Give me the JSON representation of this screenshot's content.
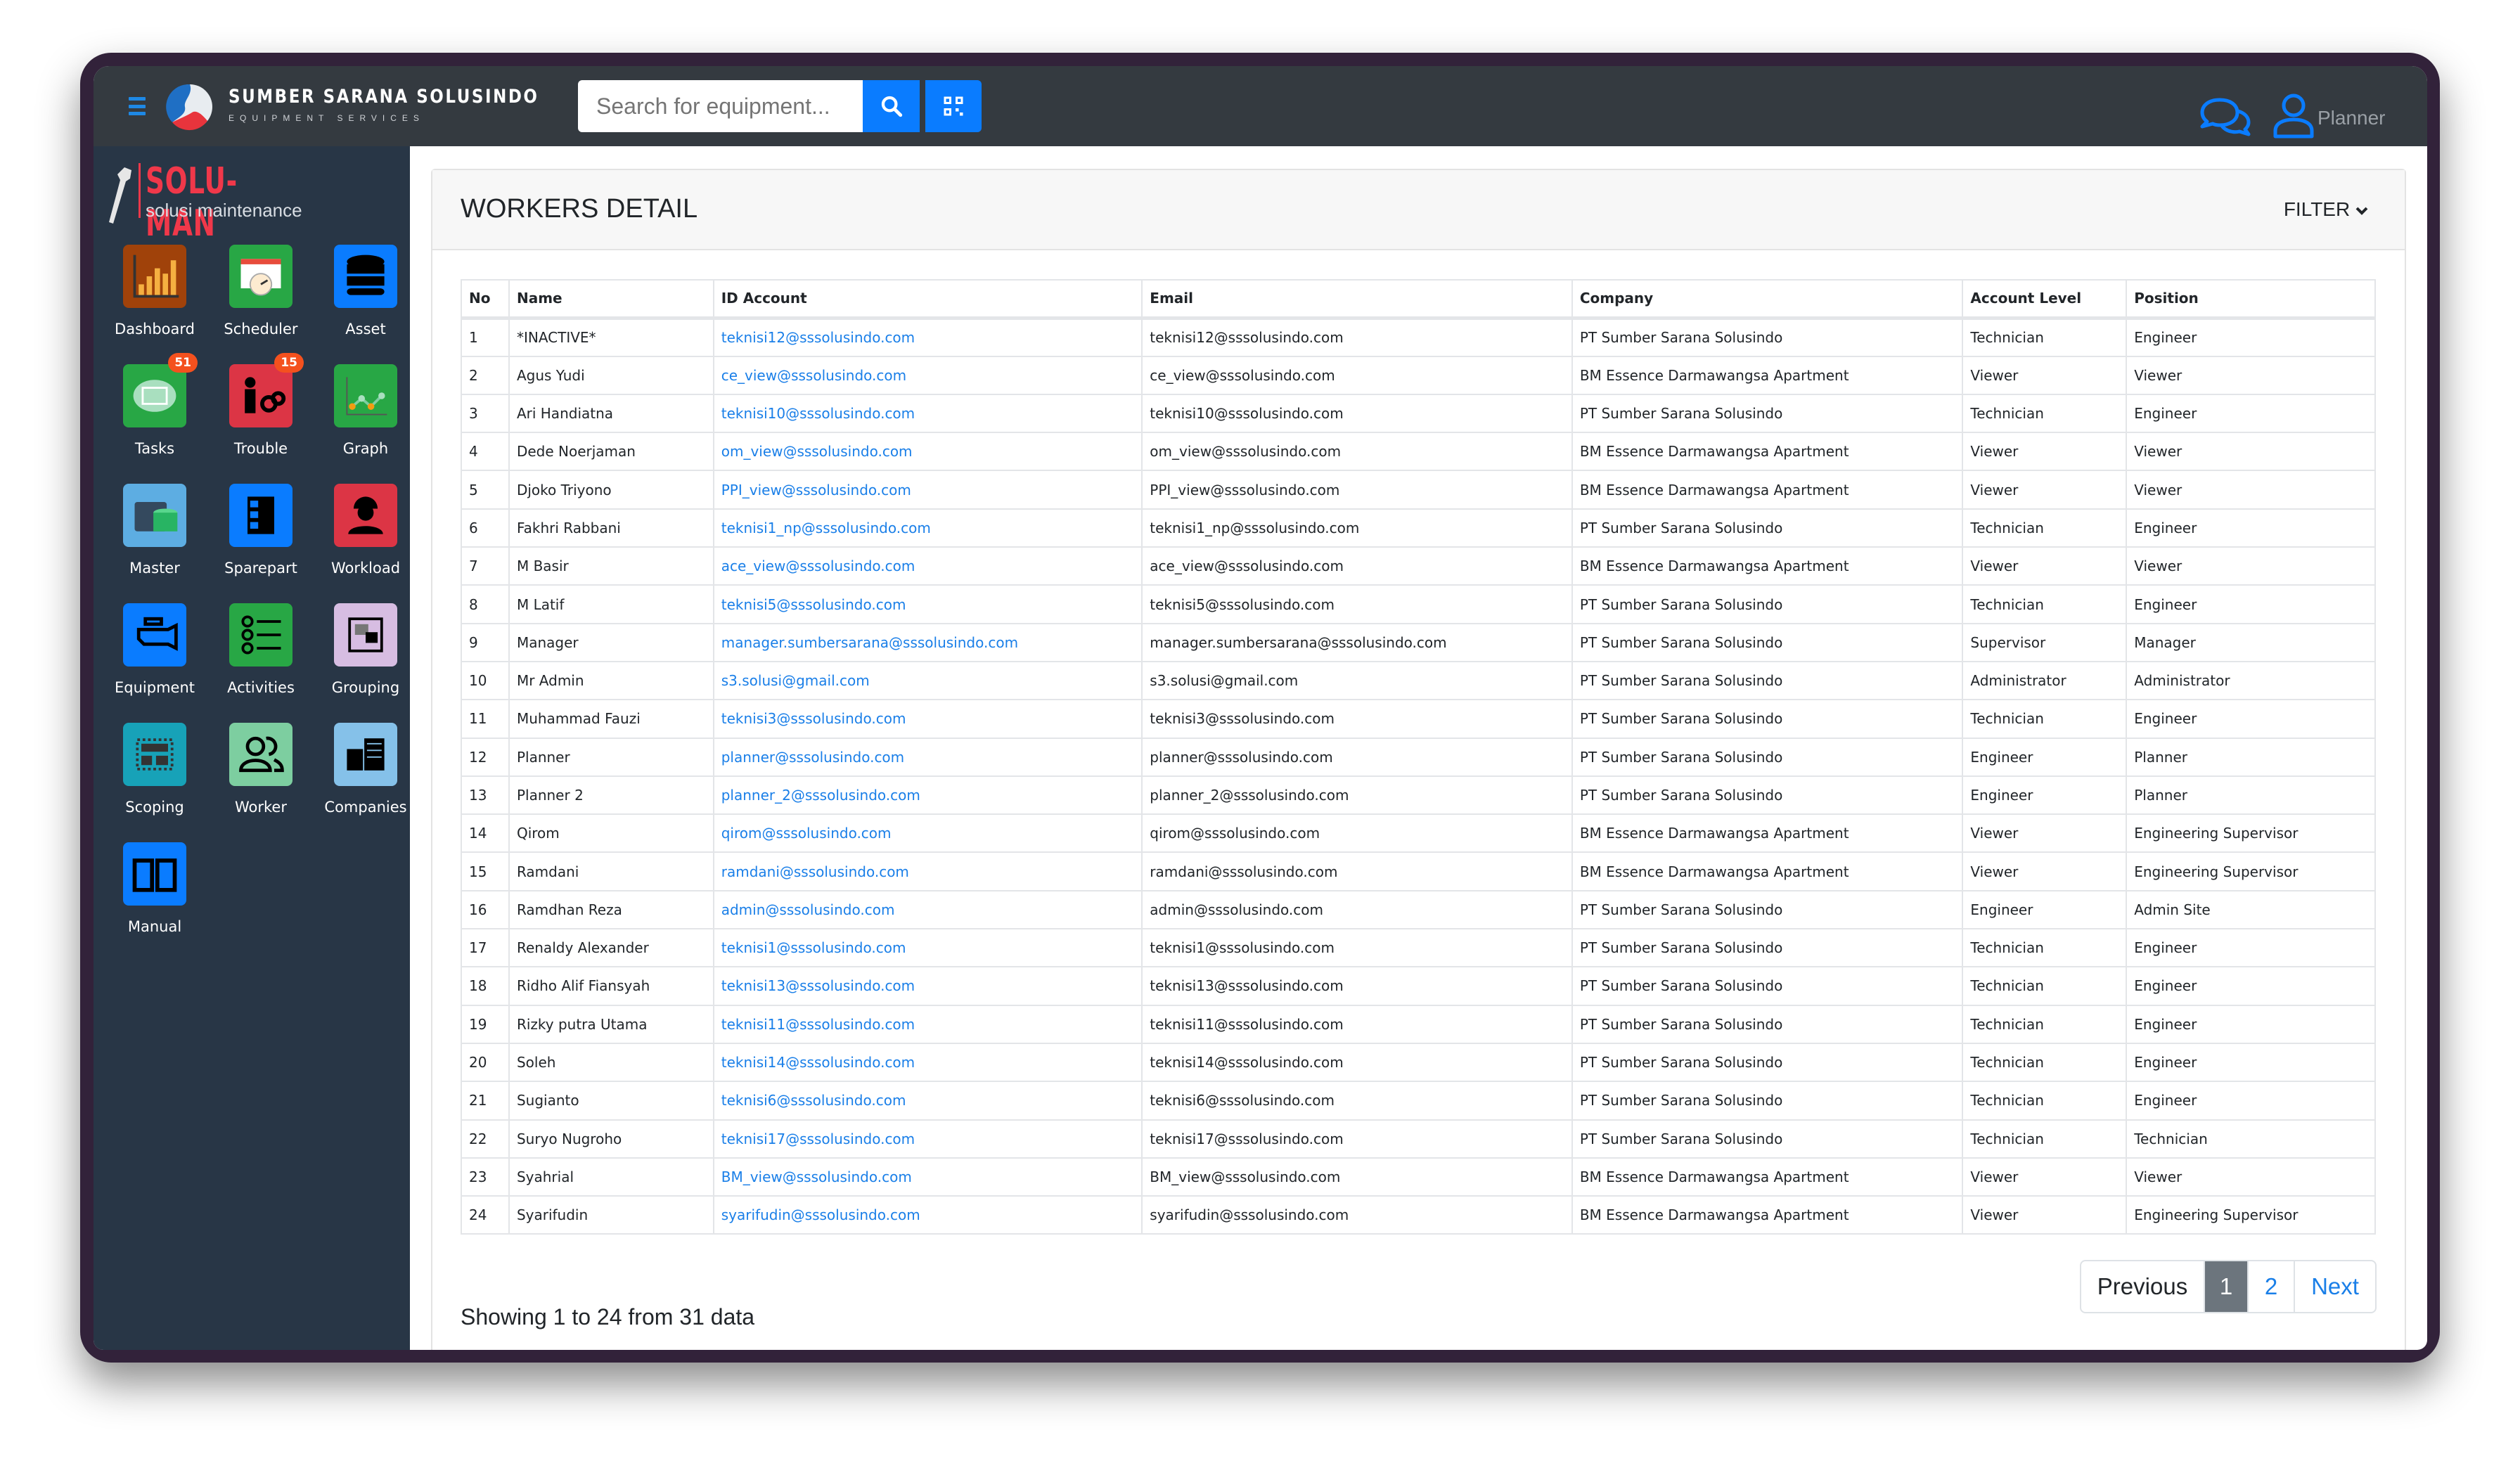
{
  "header": {
    "brand_name": "SUMBER SARANA SOLUSINDO",
    "brand_tagline": "EQUIPMENT SERVICES",
    "search_placeholder": "Search for equipment...",
    "user_name": "Planner"
  },
  "sidebar": {
    "logo_name": "SOLU-MAN",
    "logo_sub": "solusi maintenance",
    "items": [
      {
        "label": "Dashboard",
        "icon": "bar-chart-icon",
        "color": "#a0420a"
      },
      {
        "label": "Scheduler",
        "icon": "calendar-clock-icon",
        "color": "#28a745"
      },
      {
        "label": "Asset",
        "icon": "database-icon",
        "color": "#0a7cff"
      },
      {
        "label": "Tasks",
        "icon": "task-card-icon",
        "color": "#28a745",
        "badge": "51"
      },
      {
        "label": "Trouble",
        "icon": "trouble-gears-icon",
        "color": "#dc3545",
        "badge": "15"
      },
      {
        "label": "Graph",
        "icon": "line-graph-icon",
        "color": "#28a745"
      },
      {
        "label": "Master",
        "icon": "server-data-icon",
        "color": "#5dade2"
      },
      {
        "label": "Sparepart",
        "icon": "shelf-icon",
        "color": "#0a7cff"
      },
      {
        "label": "Workload",
        "icon": "worker-helmet-icon",
        "color": "#dc3545"
      },
      {
        "label": "Equipment",
        "icon": "engine-icon",
        "color": "#0a7cff"
      },
      {
        "label": "Activities",
        "icon": "checklist-icon",
        "color": "#28a745"
      },
      {
        "label": "Grouping",
        "icon": "group-select-icon",
        "color": "#d7bde2"
      },
      {
        "label": "Scoping",
        "icon": "layout-scope-icon",
        "color": "#17a2b8"
      },
      {
        "label": "Worker",
        "icon": "users-icon",
        "color": "#7dcea0"
      },
      {
        "label": "Companies",
        "icon": "buildings-icon",
        "color": "#85c1e9"
      },
      {
        "label": "Manual",
        "icon": "book-icon",
        "color": "#0a7cff"
      }
    ]
  },
  "main": {
    "title": "WORKERS DETAIL",
    "filter_label": "FILTER",
    "columns": [
      "No",
      "Name",
      "ID Account",
      "Email",
      "Company",
      "Account Level",
      "Position"
    ],
    "rows": [
      [
        "1",
        "*INACTIVE*",
        "teknisi12@sssolusindo.com",
        "teknisi12@sssolusindo.com",
        "PT Sumber Sarana Solusindo",
        "Technician",
        "Engineer"
      ],
      [
        "2",
        "Agus Yudi",
        "ce_view@sssolusindo.com",
        "ce_view@sssolusindo.com",
        "BM Essence Darmawangsa Apartment",
        "Viewer",
        "Viewer"
      ],
      [
        "3",
        "Ari Handiatna",
        "teknisi10@sssolusindo.com",
        "teknisi10@sssolusindo.com",
        "PT Sumber Sarana Solusindo",
        "Technician",
        "Engineer"
      ],
      [
        "4",
        "Dede Noerjaman",
        "om_view@sssolusindo.com",
        "om_view@sssolusindo.com",
        "BM Essence Darmawangsa Apartment",
        "Viewer",
        "Viewer"
      ],
      [
        "5",
        "Djoko Triyono",
        "PPI_view@sssolusindo.com",
        "PPI_view@sssolusindo.com",
        "BM Essence Darmawangsa Apartment",
        "Viewer",
        "Viewer"
      ],
      [
        "6",
        "Fakhri Rabbani",
        "teknisi1_np@sssolusindo.com",
        "teknisi1_np@sssolusindo.com",
        "PT Sumber Sarana Solusindo",
        "Technician",
        "Engineer"
      ],
      [
        "7",
        "M Basir",
        "ace_view@sssolusindo.com",
        "ace_view@sssolusindo.com",
        "BM Essence Darmawangsa Apartment",
        "Viewer",
        "Viewer"
      ],
      [
        "8",
        "M Latif",
        "teknisi5@sssolusindo.com",
        "teknisi5@sssolusindo.com",
        "PT Sumber Sarana Solusindo",
        "Technician",
        "Engineer"
      ],
      [
        "9",
        "Manager",
        "manager.sumbersarana@sssolusindo.com",
        "manager.sumbersarana@sssolusindo.com",
        "PT Sumber Sarana Solusindo",
        "Supervisor",
        "Manager"
      ],
      [
        "10",
        "Mr Admin",
        "s3.solusi@gmail.com",
        "s3.solusi@gmail.com",
        "PT Sumber Sarana Solusindo",
        "Administrator",
        "Administrator"
      ],
      [
        "11",
        "Muhammad Fauzi",
        "teknisi3@sssolusindo.com",
        "teknisi3@sssolusindo.com",
        "PT Sumber Sarana Solusindo",
        "Technician",
        "Engineer"
      ],
      [
        "12",
        "Planner",
        "planner@sssolusindo.com",
        "planner@sssolusindo.com",
        "PT Sumber Sarana Solusindo",
        "Engineer",
        "Planner"
      ],
      [
        "13",
        "Planner 2",
        "planner_2@sssolusindo.com",
        "planner_2@sssolusindo.com",
        "PT Sumber Sarana Solusindo",
        "Engineer",
        "Planner"
      ],
      [
        "14",
        "Qirom",
        "qirom@sssolusindo.com",
        "qirom@sssolusindo.com",
        "BM Essence Darmawangsa Apartment",
        "Viewer",
        "Engineering Supervisor"
      ],
      [
        "15",
        "Ramdani",
        "ramdani@sssolusindo.com",
        "ramdani@sssolusindo.com",
        "BM Essence Darmawangsa Apartment",
        "Viewer",
        "Engineering Supervisor"
      ],
      [
        "16",
        "Ramdhan Reza",
        "admin@sssolusindo.com",
        "admin@sssolusindo.com",
        "PT Sumber Sarana Solusindo",
        "Engineer",
        "Admin Site"
      ],
      [
        "17",
        "Renaldy Alexander",
        "teknisi1@sssolusindo.com",
        "teknisi1@sssolusindo.com",
        "PT Sumber Sarana Solusindo",
        "Technician",
        "Engineer"
      ],
      [
        "18",
        "Ridho Alif Fiansyah",
        "teknisi13@sssolusindo.com",
        "teknisi13@sssolusindo.com",
        "PT Sumber Sarana Solusindo",
        "Technician",
        "Engineer"
      ],
      [
        "19",
        "Rizky putra Utama",
        "teknisi11@sssolusindo.com",
        "teknisi11@sssolusindo.com",
        "PT Sumber Sarana Solusindo",
        "Technician",
        "Engineer"
      ],
      [
        "20",
        "Soleh",
        "teknisi14@sssolusindo.com",
        "teknisi14@sssolusindo.com",
        "PT Sumber Sarana Solusindo",
        "Technician",
        "Engineer"
      ],
      [
        "21",
        "Sugianto",
        "teknisi6@sssolusindo.com",
        "teknisi6@sssolusindo.com",
        "PT Sumber Sarana Solusindo",
        "Technician",
        "Engineer"
      ],
      [
        "22",
        "Suryo Nugroho",
        "teknisi17@sssolusindo.com",
        "teknisi17@sssolusindo.com",
        "PT Sumber Sarana Solusindo",
        "Technician",
        "Technician"
      ],
      [
        "23",
        "Syahrial",
        "BM_view@sssolusindo.com",
        "BM_view@sssolusindo.com",
        "BM Essence Darmawangsa Apartment",
        "Viewer",
        "Viewer"
      ],
      [
        "24",
        "Syarifudin",
        "syarifudin@sssolusindo.com",
        "syarifudin@sssolusindo.com",
        "BM Essence Darmawangsa Apartment",
        "Viewer",
        "Engineering Supervisor"
      ]
    ],
    "showing_text": "Showing 1 to 24 from 31 data",
    "pagination": {
      "previous": "Previous",
      "pages": [
        "1",
        "2"
      ],
      "active_page": "1",
      "next": "Next"
    }
  },
  "colors": {
    "accent": "#0a7cff",
    "topbar": "#343a40",
    "sidebar": "#283646",
    "active_page": "#6c757d"
  }
}
